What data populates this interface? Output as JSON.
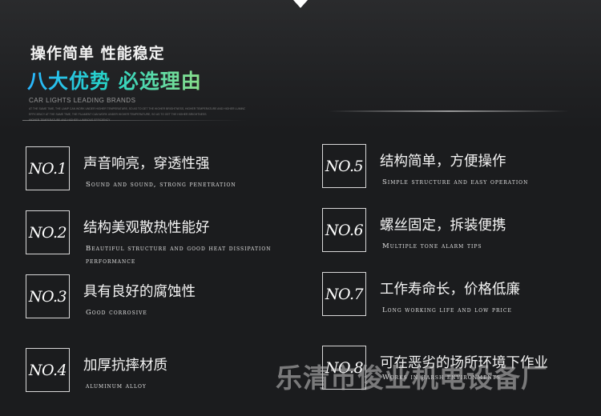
{
  "header": {
    "subtitle": "操作简单 性能稳定",
    "headline": "八大优势 必选理由",
    "brand": "CAR LIGHTS LEADING BRANDS",
    "fine_lines": [
      "AT THE SAME TIME, THE LAMP CAN WORK UNDER HIGHER TEMPERATURE, SO AS TO GET THE HIGHER BRIGHTNESS, HIGHER TEMPERATURE AND HIGHER LUMINOUS",
      "EFFICIENCY AT THE SAME TIME, THE FILAMENT CAN WORK UNDER HIGHER TEMPERATURE, SO AS TO GET THE HIGHER BRIGHTNESS",
      "HIGHER TEMPERATURE AND HIGHER LUMINOUS EFFICIENCY"
    ]
  },
  "features": [
    {
      "no": "NO.1",
      "cn": "声音响亮，穿透性强",
      "en": "Sound and sound, strong penetration"
    },
    {
      "no": "NO.2",
      "cn": "结构美观散热性能好",
      "en": "Beautiful structure and good heat dissipation performance"
    },
    {
      "no": "NO.3",
      "cn": "具有良好的腐蚀性",
      "en": "Good corrosive"
    },
    {
      "no": "NO.4",
      "cn": "加厚抗摔材质",
      "en": "aluminum alloy"
    },
    {
      "no": "NO.5",
      "cn": "结构简单，方便操作",
      "en": "Simple structure and easy operation"
    },
    {
      "no": "NO.6",
      "cn": "螺丝固定，拆装便携",
      "en": "Multiple tone alarm tips"
    },
    {
      "no": "NO.7",
      "cn": "工作寿命长，价格低廉",
      "en": "Long working life and low price"
    },
    {
      "no": "NO.8",
      "cn": "可在恶劣的场所环境下作业",
      "en": "Works in harsh environments"
    }
  ],
  "watermark": "乐清市俊业机电设备厂"
}
